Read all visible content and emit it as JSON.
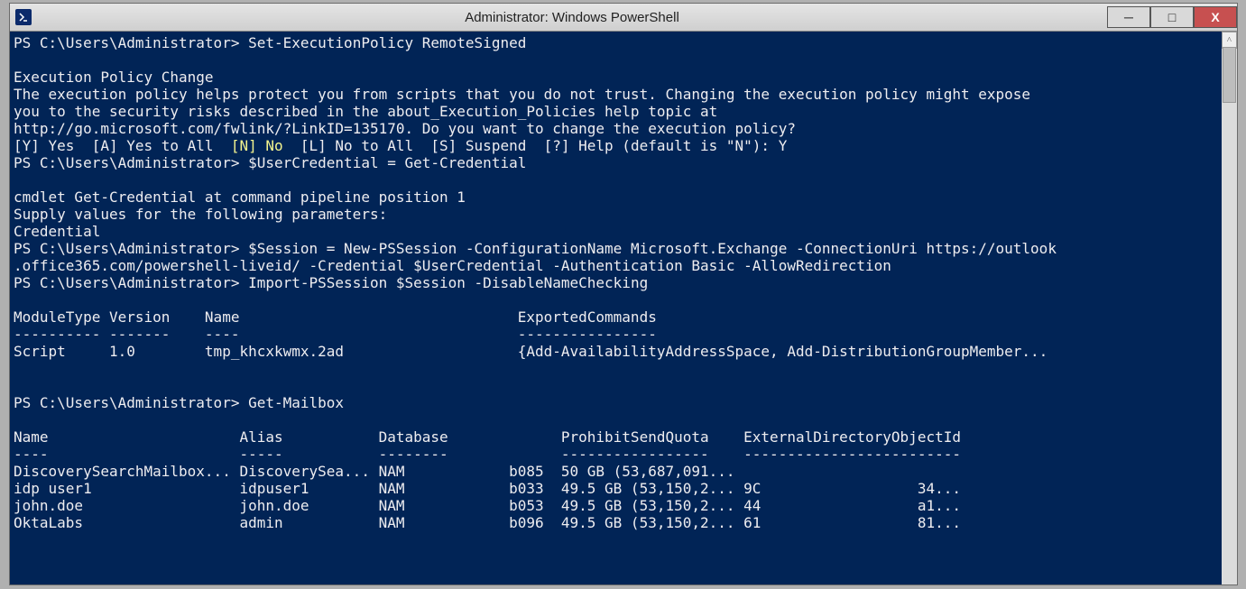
{
  "window": {
    "title": "Administrator: Windows PowerShell",
    "minimize": "─",
    "maximize": "□",
    "close": "X"
  },
  "scroll": {
    "up_glyph": "˄"
  },
  "console": {
    "line1_prompt": "PS C:\\Users\\Administrator> ",
    "line1_cmd": "Set-ExecutionPolicy RemoteSigned",
    "blank1": "",
    "epc_title": "Execution Policy Change",
    "epc_body1": "The execution policy helps protect you from scripts that you do not trust. Changing the execution policy might expose",
    "epc_body2": "you to the security risks described in the about_Execution_Policies help topic at",
    "epc_body3": "http://go.microsoft.com/fwlink/?LinkID=135170. Do you want to change the execution policy?",
    "prompt_pre": "[Y] Yes  [A] Yes to All  ",
    "prompt_default": "[N] No",
    "prompt_post": "  [L] No to All  [S] Suspend  [?] Help (default is \"N\"): Y",
    "line2_prompt": "PS C:\\Users\\Administrator> ",
    "line2_cmd": "$UserCredential = Get-Credential",
    "blank2": "",
    "cred1": "cmdlet Get-Credential at command pipeline position 1",
    "cred2": "Supply values for the following parameters:",
    "cred3": "Credential",
    "line3_prompt": "PS C:\\Users\\Administrator> ",
    "line3_cmd": "$Session = New-PSSession -ConfigurationName Microsoft.Exchange -ConnectionUri https://outlook",
    "line3_cont": ".office365.com/powershell-liveid/ -Credential $UserCredential -Authentication Basic -AllowRedirection",
    "line4_prompt": "PS C:\\Users\\Administrator> ",
    "line4_cmd": "Import-PSSession $Session -DisableNameChecking",
    "blank3": "",
    "mod_hdr": "ModuleType Version    Name                                ExportedCommands",
    "mod_sep": "---------- -------    ----                                ----------------",
    "mod_row": "Script     1.0        tmp_khcxkwmx.2ad                    {Add-AvailabilityAddressSpace, Add-DistributionGroupMember...",
    "blank4": "",
    "blank5": "",
    "line5_prompt": "PS C:\\Users\\Administrator> ",
    "line5_cmd": "Get-Mailbox",
    "blank6": "",
    "mb_hdr": "Name                      Alias           Database             ProhibitSendQuota    ExternalDirectoryObjectId",
    "mb_sep": "----                      -----           --------             -----------------    -------------------------",
    "mb_row1": "DiscoverySearchMailbox... DiscoverySea... NAM            b085  50 GB (53,687,091...",
    "mb_row2": "idp user1                 idpuser1        NAM            b033  49.5 GB (53,150,2... 9C                  34...",
    "mb_row3": "john.doe                  john.doe        NAM            b053  49.5 GB (53,150,2... 44                  a1...",
    "mb_row4": "OktaLabs                  admin           NAM            b096  49.5 GB (53,150,2... 61                  81..."
  },
  "table_module": {
    "headers": [
      "ModuleType",
      "Version",
      "Name",
      "ExportedCommands"
    ],
    "rows": [
      [
        "Script",
        "1.0",
        "tmp_khcxkwmx.2ad",
        "{Add-AvailabilityAddressSpace, Add-DistributionGroupMember..."
      ]
    ]
  },
  "table_mailbox": {
    "headers": [
      "Name",
      "Alias",
      "Database",
      "ProhibitSendQuota",
      "ExternalDirectoryObjectId"
    ],
    "rows": [
      [
        "DiscoverySearchMailbox...",
        "DiscoverySea...",
        "NAM   b085",
        "50 GB (53,687,091...",
        ""
      ],
      [
        "idp user1",
        "idpuser1",
        "NAM   b033",
        "49.5 GB (53,150,2...",
        "9C   34..."
      ],
      [
        "john.doe",
        "john.doe",
        "NAM   b053",
        "49.5 GB (53,150,2...",
        "44   a1..."
      ],
      [
        "OktaLabs",
        "admin",
        "NAM   b096",
        "49.5 GB (53,150,2...",
        "61   81..."
      ]
    ]
  }
}
